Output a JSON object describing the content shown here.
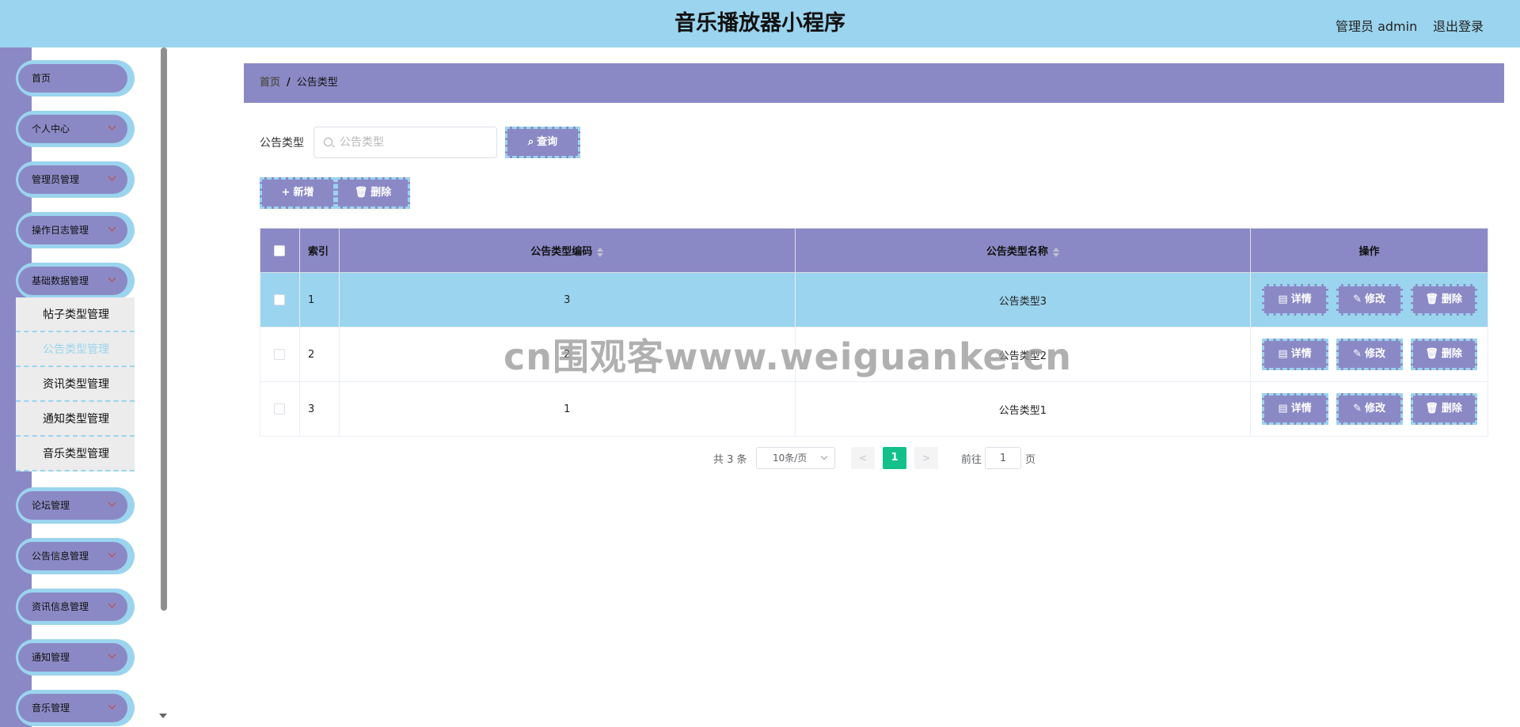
{
  "header": {
    "title": "音乐播放器小程序",
    "admin_label": "管理员 admin",
    "logout_label": "退出登录"
  },
  "sidebar": {
    "items": [
      {
        "label": "首页",
        "has_children": false
      },
      {
        "label": "个人中心",
        "has_children": true
      },
      {
        "label": "管理员管理",
        "has_children": true
      },
      {
        "label": "操作日志管理",
        "has_children": true
      },
      {
        "label": "基础数据管理",
        "has_children": true,
        "expanded": true
      },
      {
        "label": "论坛管理",
        "has_children": true
      },
      {
        "label": "公告信息管理",
        "has_children": true
      },
      {
        "label": "资讯信息管理",
        "has_children": true
      },
      {
        "label": "通知管理",
        "has_children": true
      },
      {
        "label": "音乐管理",
        "has_children": true
      }
    ],
    "submenu": [
      {
        "label": "帖子类型管理",
        "active": false
      },
      {
        "label": "公告类型管理",
        "active": true
      },
      {
        "label": "资讯类型管理",
        "active": false
      },
      {
        "label": "通知类型管理",
        "active": false
      },
      {
        "label": "音乐类型管理",
        "active": false
      }
    ]
  },
  "breadcrumb": {
    "home": "首页",
    "separator": "/",
    "current": "公告类型"
  },
  "search": {
    "label": "公告类型",
    "placeholder": "公告类型",
    "value": "",
    "query_button": "查询"
  },
  "toolbar": {
    "add_label": "新增",
    "delete_label": "删除"
  },
  "table": {
    "headers": {
      "index": "索引",
      "code": "公告类型编码",
      "name": "公告类型名称",
      "actions": "操作"
    },
    "rows": [
      {
        "index": "1",
        "code": "3",
        "name": "公告类型3"
      },
      {
        "index": "2",
        "code": "2",
        "name": "公告类型2"
      },
      {
        "index": "3",
        "code": "1",
        "name": "公告类型1"
      }
    ],
    "row_actions": {
      "detail": "详情",
      "edit": "修改",
      "delete": "删除"
    }
  },
  "pagination": {
    "total_text": "共 3 条",
    "page_size": "10条/页",
    "current_page": "1",
    "goto_label": "前往",
    "goto_value": "1",
    "page_suffix": "页"
  },
  "watermark": "cn围观客www.weiguanke.cn",
  "colors": {
    "header_bg": "#9bd4ee",
    "accent_purple": "#8b89c5",
    "active_page": "#13c08a"
  }
}
